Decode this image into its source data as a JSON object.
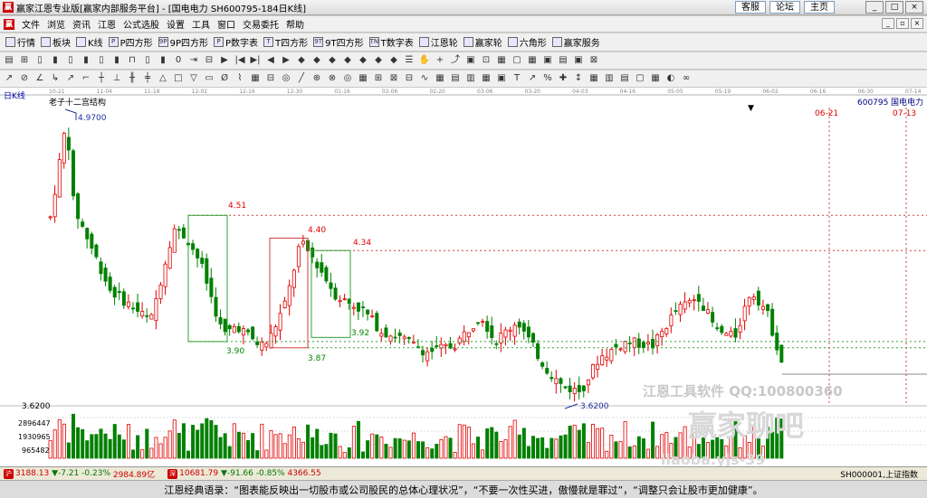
{
  "window": {
    "title": "赢家江恩专业版[赢家内部服务平台] - [国电电力  SH600795-184日K线]",
    "links": [
      "客服",
      "论坛",
      "主页"
    ],
    "controls": [
      "_",
      "□",
      "×"
    ]
  },
  "menu": [
    "文件",
    "浏览",
    "资讯",
    "江恩",
    "公式选股",
    "设置",
    "工具",
    "窗口",
    "交易委托",
    "帮助"
  ],
  "mdi_controls": [
    "_",
    "▫",
    "×"
  ],
  "toolbar1": [
    {
      "icon": "grid",
      "label": "行情"
    },
    {
      "icon": "block",
      "label": "板块"
    },
    {
      "icon": "kline",
      "label": "K线"
    },
    {
      "icon": "P",
      "label": "P四方形"
    },
    {
      "icon": "9P",
      "label": "9P四方形"
    },
    {
      "icon": "P",
      "label": "P数字表"
    },
    {
      "icon": "T",
      "label": "T四方形"
    },
    {
      "icon": "9T",
      "label": "9T四方形"
    },
    {
      "icon": "TN",
      "label": "T数字表"
    },
    {
      "icon": "circle",
      "label": "江恩轮"
    },
    {
      "icon": "circle",
      "label": "赢家轮"
    },
    {
      "icon": "star",
      "label": "六角形"
    },
    {
      "icon": "dollar",
      "label": "赢家服务"
    }
  ],
  "toolbar2_icons": [
    "▤",
    "⊞",
    "▯",
    "▮",
    "▯",
    "▮",
    "▯",
    "▮",
    "⊓",
    "▯",
    "▮",
    "0",
    "⇥",
    "⊟",
    "▶",
    "|◀",
    "▶|",
    "◀",
    "▶",
    "◆",
    "◆",
    "◆",
    "◆",
    "◆",
    "◆",
    "◆",
    "☰",
    "✋",
    "+",
    "⤴",
    "▣",
    "⊡",
    "▦",
    "▢",
    "▦",
    "▣",
    "▤",
    "▣",
    "⊠"
  ],
  "toolbar3_icons": [
    "↗",
    "⊘",
    "∠",
    "↳",
    "↗",
    "⌐",
    "┼",
    "⊥",
    "╫",
    "╪",
    "△",
    "□",
    "▽",
    "▭",
    "Ø",
    "⌇",
    "▦",
    "⊟",
    "◎",
    "╱",
    "⊕",
    "⊗",
    "◎",
    "▦",
    "⊞",
    "⊠",
    "⊟",
    "∿",
    "▦",
    "▤",
    "▥",
    "▦",
    "▣",
    "T",
    "↗",
    "%",
    "✚",
    "↕",
    "▦",
    "▥",
    "▤",
    "▢",
    "▦",
    "◐",
    "∞"
  ],
  "chart": {
    "panel_label": "日K线",
    "stock_code": "600795",
    "stock_name": "国电电力",
    "pattern_label": "老子十二宫结构",
    "top_axis_dates": [
      "10-21",
      "11-04",
      "11-18",
      "12-02",
      "12-16",
      "12-30",
      "01-16",
      "02-06",
      "02-20",
      "03-06",
      "03-20",
      "04-03",
      "04-16",
      "05-05",
      "05-19",
      "06-02",
      "06-16",
      "06-30",
      "07-14"
    ],
    "future_dates": [
      "06-21",
      "07-13"
    ],
    "price_labels": [
      "4.9700",
      "4.51",
      "4.40",
      "4.34",
      "3.90",
      "3.87",
      "3.92",
      "3.6200"
    ],
    "y_axis_price": "3.6200",
    "volume_ticks": [
      "2896447",
      "1930965",
      "965482"
    ],
    "watermark1": "江恩工具软件  QQ:100800360",
    "watermark2": "赢家聊吧",
    "watermark3": "liaoba.yjs-39"
  },
  "status": {
    "sh_index": "3188.13",
    "sh_change": "▼-7.21",
    "sh_pct": "-0.23%",
    "sh_amount": "2984.89亿",
    "sz_index": "10681.79",
    "sz_change": "▼-91.66",
    "sz_pct": "-0.85%",
    "sz_amount": "4366.55",
    "right": "SH000001,上证指数"
  },
  "quote": "江恩经典语录：“图表能反映出一切股市或公司股民的总体心理状况”，“不要一次性买进，傲慢就是罪过”，“调整只会让股市更加健康”。",
  "colors": {
    "up": "#e00000",
    "down": "#008000",
    "marker": "#003399"
  }
}
